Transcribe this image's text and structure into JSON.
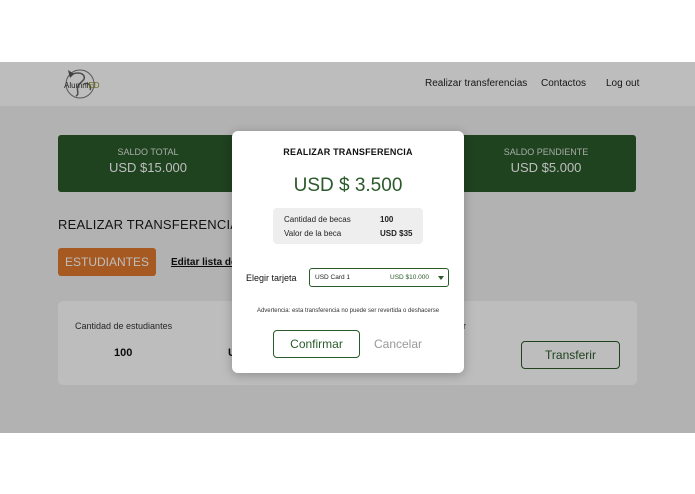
{
  "header": {
    "logo_text_prefix": "Alumni",
    "logo_text_suffix": "ED",
    "nav": [
      "Realizar transferencias",
      "Contactos",
      "Log out"
    ]
  },
  "balance_cards": [
    {
      "label": "SALDO TOTAL",
      "value": "USD $15.000"
    },
    {
      "label": "SALDO PENDIENTE",
      "value": "USD $5.000"
    }
  ],
  "page": {
    "section_title": "REALIZAR TRANSFERENCIAS",
    "tab_active": "ESTUDIANTES",
    "tab_link": "Editar lista de"
  },
  "panel": {
    "students_label": "Cantidad de estudiantes",
    "students_value": "100",
    "fragment_u": "U",
    "fragment_rir": "rir",
    "transfer_button": "Transferir"
  },
  "modal": {
    "title": "REALIZAR TRANSFERENCIA",
    "amount": "USD $ 3.500",
    "summary": [
      {
        "label": "Cantidad de becas",
        "value": "100"
      },
      {
        "label": "Valor de la beca",
        "value": "USD $35"
      }
    ],
    "card_label": "Elegir tarjeta",
    "card_select": {
      "name": "USD Card 1",
      "amount": "USD $10.000"
    },
    "warning": "Advertencia: esta transferencia no puede ser revertida o deshacerse",
    "confirm": "Confirmar",
    "cancel": "Cancelar"
  },
  "colors": {
    "brand_green": "#2a5a2a",
    "accent_orange": "#e07a2f",
    "overlay": "rgba(0,0,0,0.26)"
  },
  "icons": [
    "globe-logo-icon",
    "chevron-down-icon"
  ]
}
